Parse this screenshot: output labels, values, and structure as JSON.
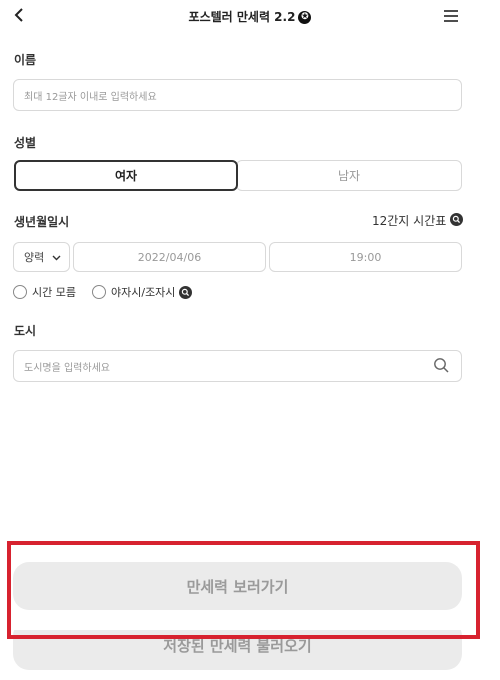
{
  "header": {
    "title": "포스텔러 만세력 2.2",
    "version_badge": "✪"
  },
  "name": {
    "label": "이름",
    "placeholder": "최대 12글자 이내로 입력하세요"
  },
  "gender": {
    "label": "성별",
    "female": "여자",
    "male": "남자",
    "selected": "여자"
  },
  "birth": {
    "label": "생년월일시",
    "zodiac_time_link": "12간지 시간표",
    "calendar_type": "양력",
    "date": "2022/04/06",
    "time": "19:00",
    "unknown_time_label": "시간 모름",
    "night_time_label": "야자시/조자시"
  },
  "city": {
    "label": "도시",
    "placeholder": "도시명을 입력하세요"
  },
  "actions": {
    "view_button": "만세력 보러가기",
    "load_button": "저장된 만세력 불러오기"
  },
  "colors": {
    "highlight": "#d7222f",
    "button_bg": "#ebebeb",
    "border": "#d9d9d9"
  },
  "icons": {
    "back": "chevron-left-icon",
    "menu": "hamburger-menu-icon",
    "search": "search-icon",
    "dropdown": "chevron-down-icon"
  }
}
